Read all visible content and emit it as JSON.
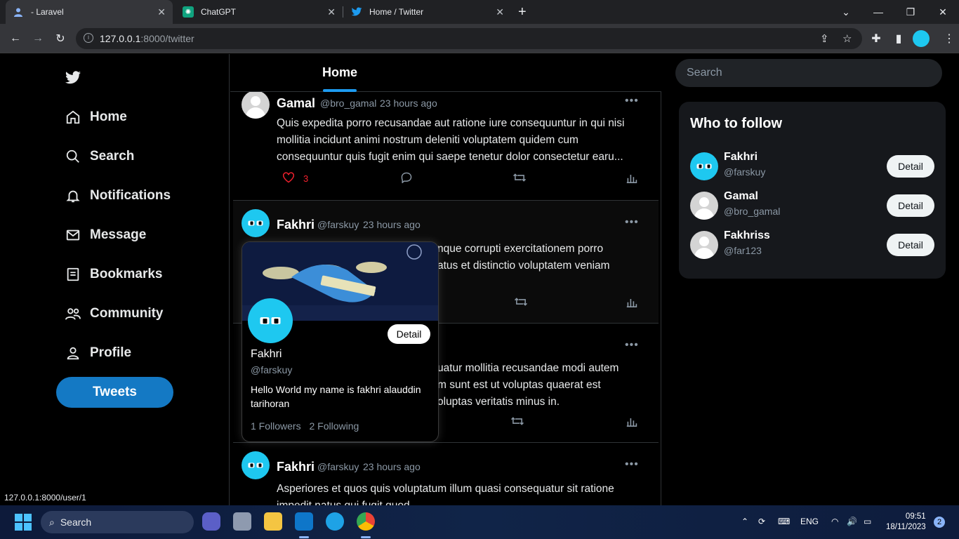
{
  "browser": {
    "tabs": [
      {
        "title": "- Laravel",
        "active": true
      },
      {
        "title": "ChatGPT",
        "active": false
      },
      {
        "title": "Home / Twitter",
        "active": false
      }
    ],
    "url_host": "127.0.0.1",
    "url_path": ":8000/twitter",
    "status_url": "127.0.0.1:8000/user/1"
  },
  "nav": {
    "logo": "twitter-bird-icon",
    "items": [
      {
        "label": "Home",
        "icon": "home-icon"
      },
      {
        "label": "Search",
        "icon": "search-icon"
      },
      {
        "label": "Notifications",
        "icon": "bell-icon"
      },
      {
        "label": "Message",
        "icon": "mail-icon"
      },
      {
        "label": "Bookmarks",
        "icon": "bookmark-icon"
      },
      {
        "label": "Community",
        "icon": "community-icon"
      },
      {
        "label": "Profile",
        "icon": "profile-icon"
      }
    ],
    "tweets_button": "Tweets"
  },
  "main": {
    "header_tab": "Home",
    "tweets": [
      {
        "name": "Gamal",
        "handle": "@bro_gamal",
        "time": "23 hours ago",
        "body": "Quis expedita porro recusandae aut ratione iure consequuntur in qui nisi mollitia incidunt animi nostrum deleniti voluptatem quidem cum consequuntur quis fugit enim qui saepe tenetur dolor consectetur earu...",
        "likes": "3"
      },
      {
        "name": "Fakhri",
        "handle": "@farskuy",
        "time": "23 hours ago",
        "body_visible_line1": "nque corrupti exercitationem porro",
        "body_visible_line2": "atus et distinctio voluptatem veniam"
      },
      {
        "body_visible_line1": "uatur mollitia recusandae modi autem",
        "body_visible_line2": "m sunt est ut voluptas quaerat est",
        "body_visible_line3": "oluptas veritatis minus in."
      },
      {
        "name": "Fakhri",
        "handle": "@farskuy",
        "time": "23 hours ago",
        "body": "Asperiores et quos quis voluptatum illum quasi consequatur sit ratione impedit natus qui fugit quod"
      }
    ]
  },
  "hovercard": {
    "name": "Fakhri",
    "handle": "@farskuy",
    "detail_label": "Detail",
    "bio": "Hello World my name is fakhri alauddin tarihoran",
    "followers": "1 Followers",
    "following": "2 Following"
  },
  "right": {
    "search_placeholder": "Search",
    "who_to_follow_title": "Who to follow",
    "suggestions": [
      {
        "name": "Fakhri",
        "handle": "@farskuy",
        "button": "Detail"
      },
      {
        "name": "Gamal",
        "handle": "@bro_gamal",
        "button": "Detail"
      },
      {
        "name": "Fakhriss",
        "handle": "@far123",
        "button": "Detail"
      }
    ]
  },
  "taskbar": {
    "search": "Search",
    "lang": "ENG",
    "time": "09:51",
    "date": "18/11/2023",
    "notifications": "2"
  },
  "colors": {
    "accent": "#1d9bf0",
    "tweets_button": "#1479c4",
    "like": "#f4212e",
    "avatar_blue": "#1ec8f0"
  }
}
